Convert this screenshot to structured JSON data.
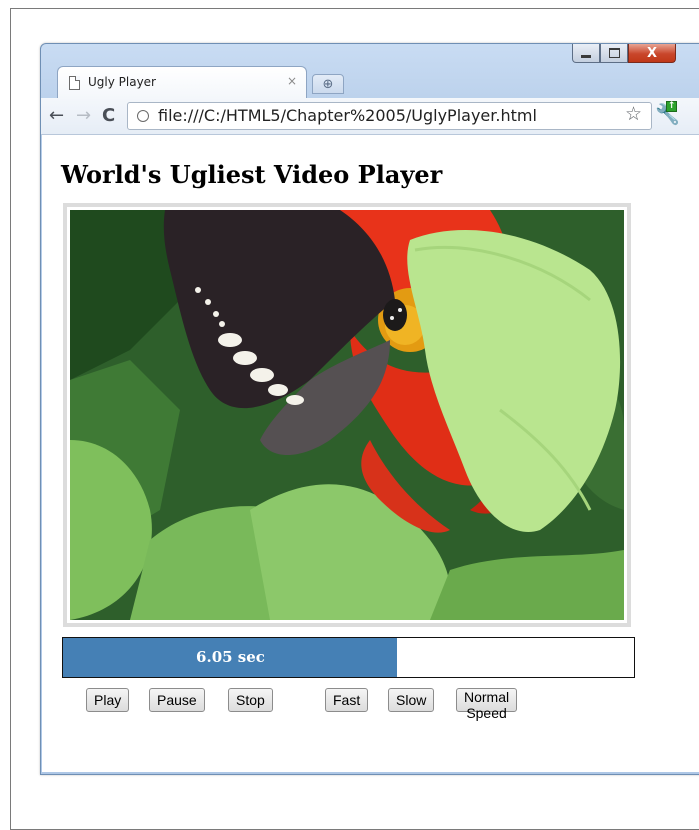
{
  "browser": {
    "tab_title": "Ugly Player",
    "tab_close": "×",
    "new_tab_glyph": "⊕",
    "url": "file:///C:/HTML5/Chapter%2005/UglyPlayer.html",
    "window_controls": {
      "close_glyph": "X"
    },
    "icons": [
      "page-icon",
      "back-arrow-icon",
      "forward-arrow-icon",
      "reload-icon",
      "star-icon",
      "wrench-icon",
      "minimize-icon",
      "maximize-icon",
      "close-icon"
    ]
  },
  "page": {
    "heading": "World's Ugliest Video Player"
  },
  "player": {
    "progress_label": "6.05 sec",
    "progress_fraction": 0.585,
    "progress_color": "#4580b5",
    "buttons": {
      "play": "Play",
      "pause": "Pause",
      "stop": "Stop",
      "fast": "Fast",
      "slow": "Slow",
      "normal": "Normal Speed"
    }
  }
}
